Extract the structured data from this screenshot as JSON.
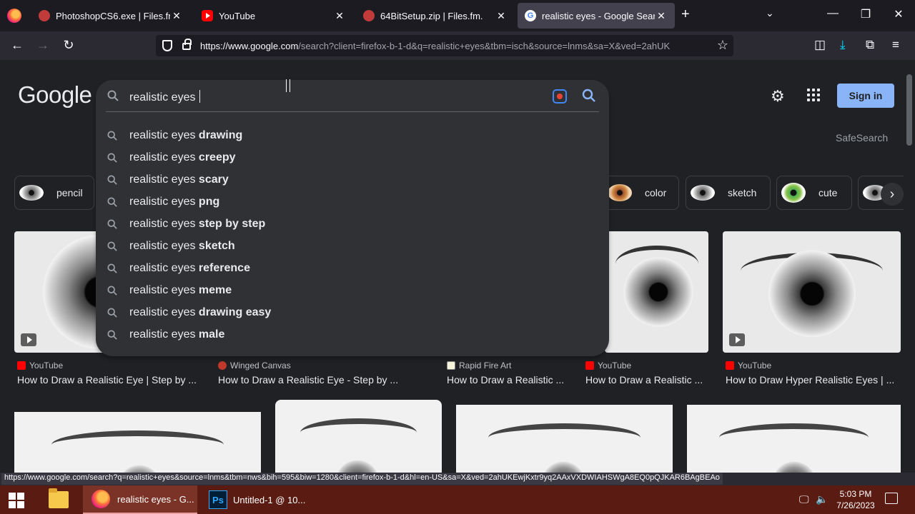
{
  "browser": {
    "tabs": [
      {
        "label": "PhotoshopCS6.exe | Files.fm.",
        "close": "✕"
      },
      {
        "label": "YouTube",
        "close": "✕"
      },
      {
        "label": "64BitSetup.zip | Files.fm.",
        "close": "✕"
      },
      {
        "label": "realistic eyes - Google Search",
        "close": "✕",
        "active": true
      }
    ],
    "new_tab": "+",
    "tab_list": "⌄",
    "window": {
      "minimize": "—",
      "restore": "❐",
      "close": "✕"
    },
    "nav": {
      "back": "←",
      "forward": "→",
      "reload": "↻"
    },
    "url_host": "https://www.google.com",
    "url_rest": "/search?client=firefox-b-1-d&q=realistic+eyes&tbm=isch&source=lnms&sa=X&ved=2ahUK",
    "star": "☆",
    "right_icons": {
      "pocket": "◫",
      "downloads": "⤓",
      "extensions": "⧉",
      "menu": "≡"
    },
    "status_url": "https://www.google.com/search?q=realistic+eyes&source=lnms&tbm=nws&bih=595&biw=1280&client=firefox-b-1-d&hl=en-US&sa=X&ved=2ahUKEwjKxtr9yq2AAxVXDWIAHSWgA8EQ0pQJKAR6BAgBEAo"
  },
  "google": {
    "logo": "Google",
    "signin": "Sign in",
    "safesearch": "SafeSearch",
    "gear": "⚙",
    "search": {
      "query": "realistic eyes ",
      "suggestions": [
        {
          "prefix": "realistic eyes ",
          "bold": "drawing"
        },
        {
          "prefix": "realistic eyes ",
          "bold": "creepy"
        },
        {
          "prefix": "realistic eyes ",
          "bold": "scary"
        },
        {
          "prefix": "realistic eyes ",
          "bold": "png"
        },
        {
          "prefix": "realistic eyes ",
          "bold": "step by step"
        },
        {
          "prefix": "realistic eyes ",
          "bold": "sketch"
        },
        {
          "prefix": "realistic eyes ",
          "bold": "reference"
        },
        {
          "prefix": "realistic eyes ",
          "bold": "meme"
        },
        {
          "prefix": "realistic eyes ",
          "bold": "drawing easy"
        },
        {
          "prefix": "realistic eyes ",
          "bold": "male"
        }
      ]
    },
    "chips": [
      {
        "label": "pencil"
      },
      {
        "label": "color"
      },
      {
        "label": "sketch"
      },
      {
        "label": "cute"
      }
    ],
    "chip_next": "›",
    "results": [
      {
        "source": "YouTube",
        "title": "How to Draw a Realistic Eye | Step by ..."
      },
      {
        "source": "Winged Canvas",
        "title": "How to Draw a Realistic Eye - Step by ..."
      },
      {
        "source": "Rapid Fire Art",
        "title": "How to Draw a Realistic ..."
      },
      {
        "source": "YouTube",
        "title": "How to Draw a Realistic ..."
      },
      {
        "source": "YouTube",
        "title": "How to Draw Hyper Realistic Eyes | ..."
      }
    ]
  },
  "taskbar": {
    "items": [
      {
        "label": "realistic eyes - G..."
      },
      {
        "label": "Untitled-1 @ 10..."
      }
    ],
    "ps_label": "Ps",
    "time": "5:03 PM",
    "date": "7/26/2023"
  }
}
